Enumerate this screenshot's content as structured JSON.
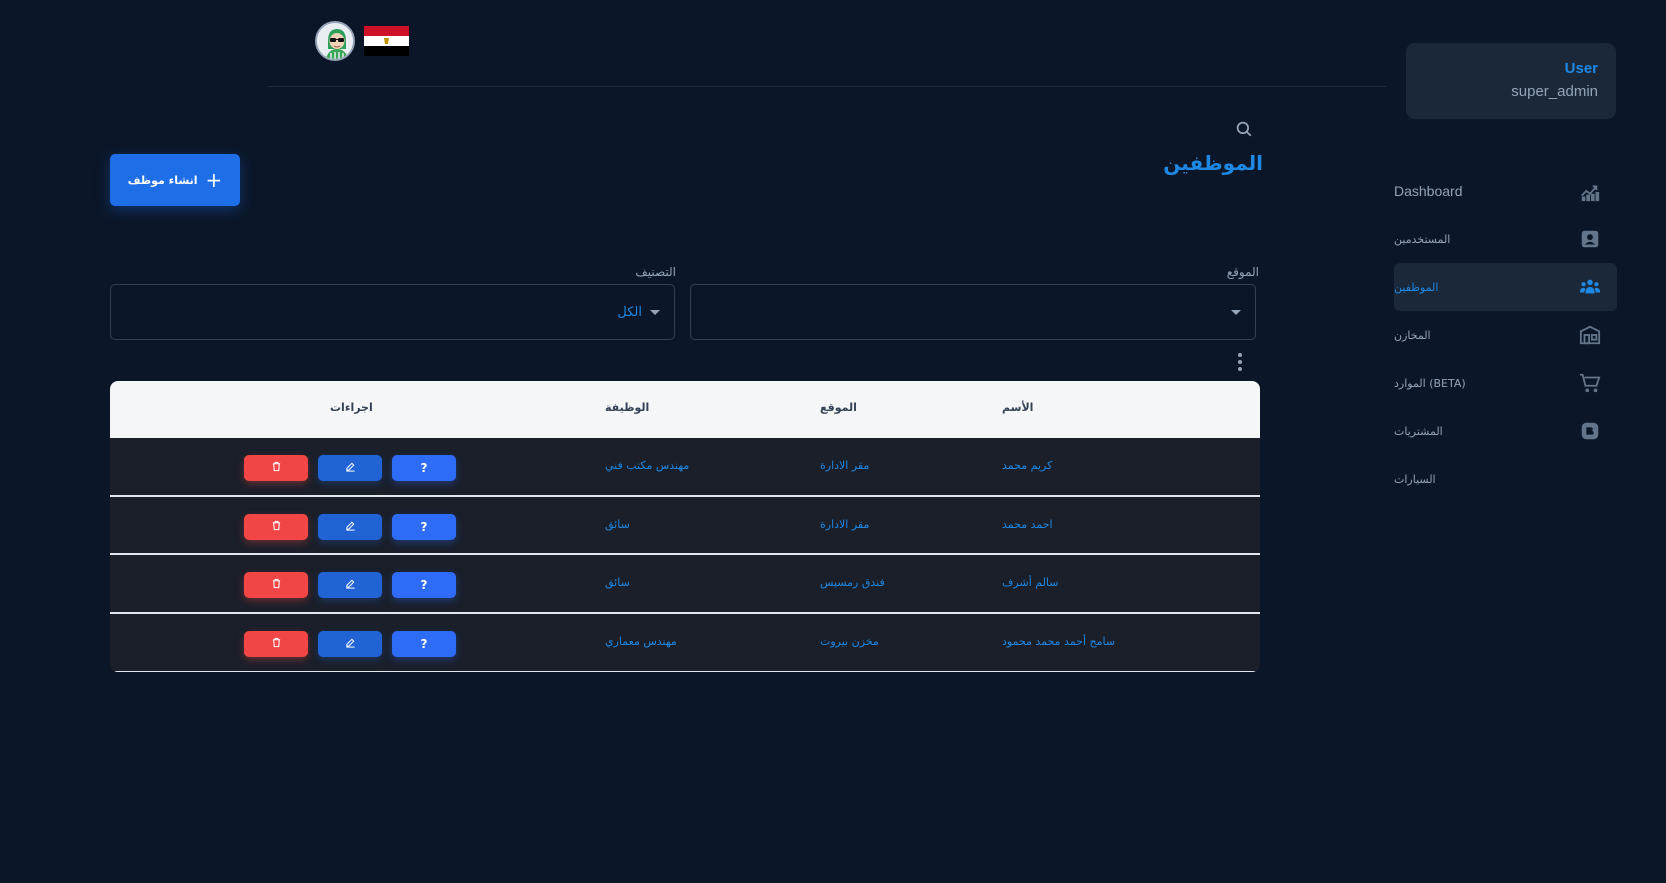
{
  "header": {
    "avatar_icon": "user-avatar-icon",
    "flag_icon": "egypt-flag-icon"
  },
  "user": {
    "name": "User",
    "role": "super_admin"
  },
  "sidebar": {
    "items": [
      {
        "label": "Dashboard",
        "icon": "chart-icon",
        "active": false
      },
      {
        "label": "المستخدمين",
        "icon": "user-icon",
        "active": false
      },
      {
        "label": "الموظفين",
        "icon": "group-icon",
        "active": true
      },
      {
        "label": "المخازن",
        "icon": "warehouse-icon",
        "active": false
      },
      {
        "label": "الموارد (BETA)",
        "icon": "cart-icon",
        "active": false
      },
      {
        "label": "المشتريات",
        "icon": "purchases-icon",
        "active": false
      },
      {
        "label": "السيارات",
        "icon": "car-icon",
        "active": false
      }
    ]
  },
  "main": {
    "title": "الموظفين",
    "create_label": "انشاء موظف",
    "filters": {
      "location_label": "الموقع",
      "location_value": "",
      "category_label": "التصنيف",
      "category_value": "الكل"
    },
    "table": {
      "headers": {
        "name": "الأسم",
        "location": "الموقع",
        "job": "الوظيفة",
        "actions": "اجراءات"
      },
      "rows": [
        {
          "name": "كريم محمد",
          "location": "مقر الادارة",
          "job": "مهندس مكتب فني"
        },
        {
          "name": "احمد محمد",
          "location": "مقر الادارة",
          "job": "سائق"
        },
        {
          "name": "سالم أشرف",
          "location": "فندق رمسيس",
          "job": "سائق"
        },
        {
          "name": "سامح أحمد محمد محمود",
          "location": "مخزن بيروت",
          "job": "مهندس معماري"
        }
      ],
      "info_label": "?"
    }
  },
  "colors": {
    "background": "#0b1628",
    "accent": "#1e88e5",
    "primary_button": "#1e6ee8",
    "danger": "#f24545"
  }
}
